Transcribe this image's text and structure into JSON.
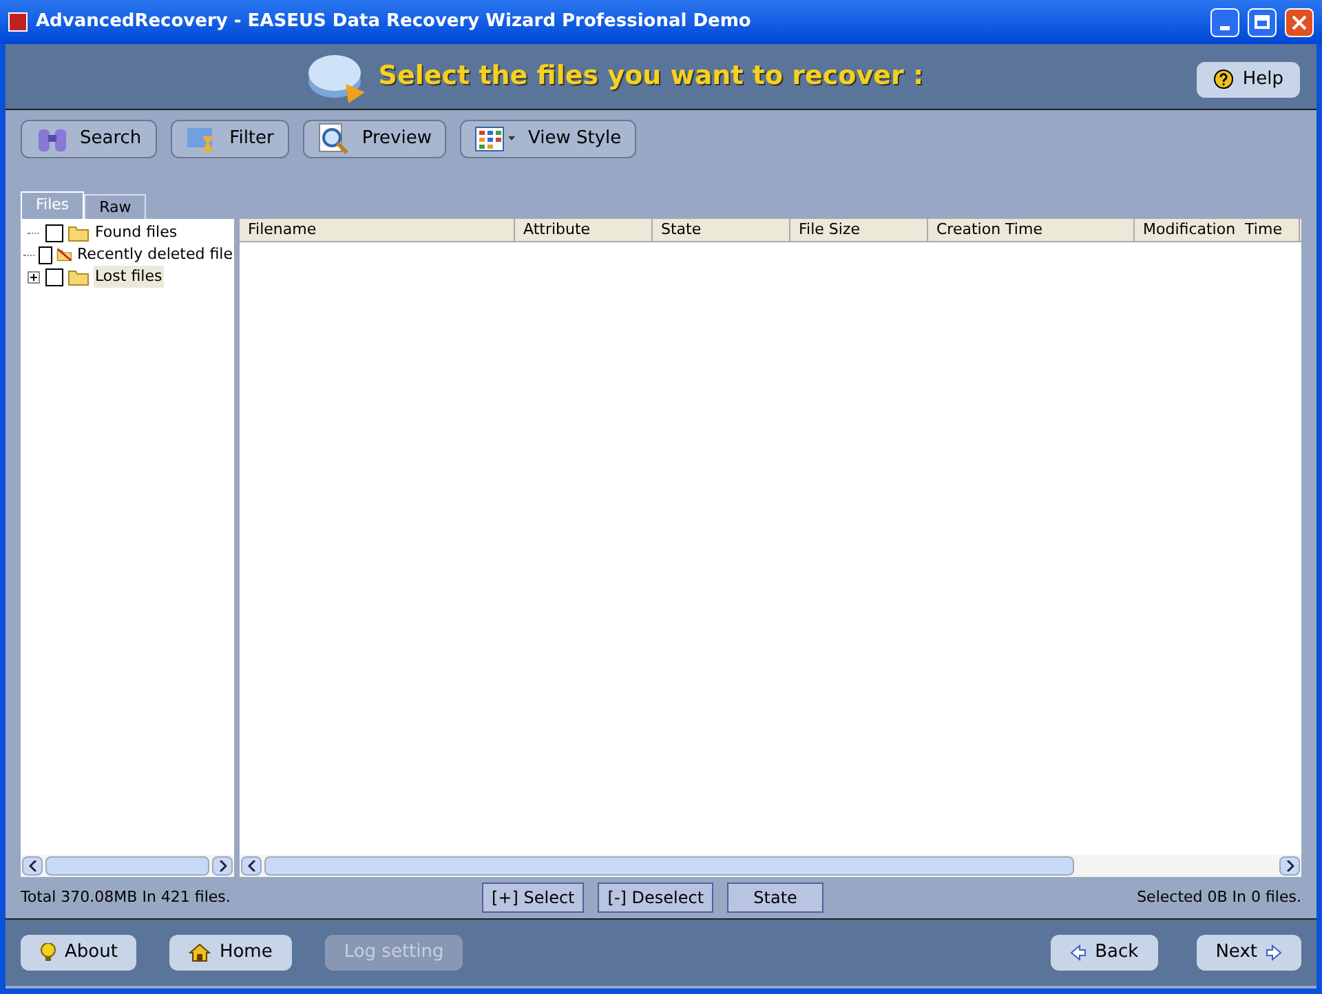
{
  "window": {
    "title": "AdvancedRecovery - EASEUS Data Recovery Wizard Professional Demo"
  },
  "header": {
    "title": "Select the files you want to recover :",
    "help": "Help"
  },
  "toolbar": [
    {
      "label": "Search",
      "kind": "search"
    },
    {
      "label": "Filter",
      "kind": "filter"
    },
    {
      "label": "Preview",
      "kind": "preview"
    },
    {
      "label": "View Style",
      "kind": "view"
    }
  ],
  "tabs": [
    {
      "label": "Files",
      "selected": true
    },
    {
      "label": "Raw",
      "selected": false
    }
  ],
  "tree": [
    {
      "label": "Found files",
      "checked": false,
      "selected": false,
      "deleted": false
    },
    {
      "label": "Recently deleted file",
      "checked": false,
      "selected": false,
      "deleted": true
    },
    {
      "label": "Lost files",
      "checked": false,
      "selected": true,
      "deleted": false,
      "expandable": true,
      "expanded": false
    }
  ],
  "table": {
    "columns": [
      "Filename",
      "Attribute",
      "State",
      "File Size",
      "Creation Time",
      "Modification  Time"
    ]
  },
  "status_left": "Total 370.08MB In 421 files.",
  "actions": [
    "[+] Select",
    "[-] Deselect",
    "State"
  ],
  "status_right": "Selected 0B In 0 files.",
  "footer_left": [
    {
      "label": "About",
      "kind": "about",
      "disabled": false
    },
    {
      "label": "Home",
      "kind": "home",
      "disabled": false
    },
    {
      "label": "Log setting",
      "kind": "log",
      "disabled": true
    }
  ],
  "footer_right": [
    {
      "label": "Back",
      "kind": "back"
    },
    {
      "label": "Next",
      "kind": "next"
    }
  ]
}
